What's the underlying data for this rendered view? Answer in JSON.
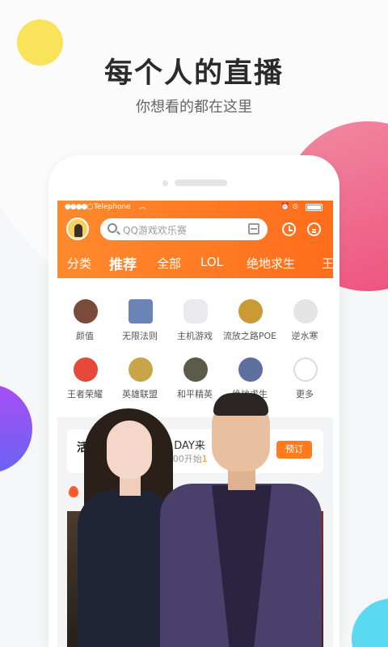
{
  "hero": {
    "title": "每个人的直播",
    "subtitle": "你想看的都在这里"
  },
  "status_bar": {
    "signal": "●●●●○",
    "carrier": "Telephone",
    "wifi": "︵",
    "icons": "⏰ ⊙"
  },
  "search": {
    "placeholder": "QQ游戏欢乐赛"
  },
  "tabs": [
    "分类",
    "推荐",
    "全部",
    "LOL",
    "绝地求生",
    "王"
  ],
  "categories": [
    {
      "label": "颜值",
      "icon": "beauty-icon",
      "color": "#7a4a3a"
    },
    {
      "label": "无限法则",
      "icon": "ring-of-elysium-icon",
      "color": "#6a84b8"
    },
    {
      "label": "主机游戏",
      "icon": "gamepad-icon",
      "color": "#e9e9ee"
    },
    {
      "label": "流放之路POE",
      "icon": "poe-icon",
      "color": "#c99a36"
    },
    {
      "label": "逆水寒",
      "icon": "nishuihan-icon",
      "color": "#e4e4e4"
    },
    {
      "label": "王者荣耀",
      "icon": "honor-of-kings-icon",
      "color": "#e6483c"
    },
    {
      "label": "英雄联盟",
      "icon": "lol-icon",
      "color": "#c8a548"
    },
    {
      "label": "和平精英",
      "icon": "peace-elite-icon",
      "color": "#5c5a48"
    },
    {
      "label": "绝地求生",
      "icon": "pubg-icon",
      "color": "#5d6f9e"
    },
    {
      "label": "更多",
      "icon": "more-icon",
      "color": "#dcdcdc"
    }
  ],
  "promo": {
    "title": "活动",
    "line1": "G DAY来",
    "line2_prefix": "0:00开始",
    "line2_highlight": "1",
    "button": "预订"
  },
  "hot": {
    "label": "热"
  },
  "colors": {
    "accent": "#ff7b1c",
    "pink": "#ee4f7b",
    "yellow": "#f8e35a"
  }
}
